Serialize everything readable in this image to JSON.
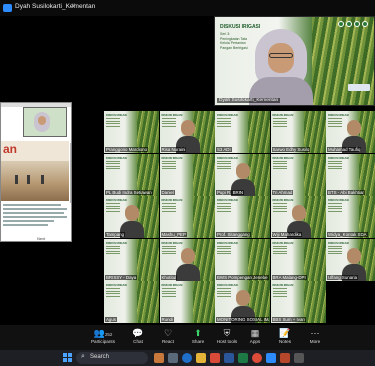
{
  "topbar": {
    "title": "Dyah Susilokarti_Kementan",
    "chevron": "∨"
  },
  "presenter": {
    "heading": "DISKUSI IRIGASI",
    "subtitle": "Seri 3: Peningkatan Tata Kelola Pertanian Pangan Beririgasi",
    "name": "Dyah Susilokarti_Kementan"
  },
  "shared_doc": {
    "heading": "an",
    "page": "Next"
  },
  "gallery": {
    "participants": [
      "Pranggono Mardiono",
      "Risa Nuraini",
      "S3 ADI",
      "Sarwo Edhy Susilo",
      "Muhamad Taufiq",
      "PL Budi Indra Setiawan",
      "Daniel",
      "Pupi R. BRIN",
      "Tri Ahmad",
      "BTS - Abi Bakhtiar",
      "Tampang",
      "Mashu_PEP",
      "Prof. Sitanggang",
      "Wiji Mahardika",
      "Widya_Kontak SDA",
      "BRISSY - Daya",
      "Khotitul",
      "BWS Pompengan Jenebe",
      "BRA Malang-DPI",
      "Ulfang Sunaria",
      "Agus",
      "Rundi",
      "MONITORING SOSIAL IMAMUDDIN",
      "BBS Sum + Ivan"
    ]
  },
  "toolbar": {
    "participants": {
      "label": "Participants",
      "count": "252",
      "icon": "people-icon"
    },
    "chat": {
      "label": "Chat",
      "icon": "chat-icon"
    },
    "react": {
      "label": "React",
      "icon": "heart-icon"
    },
    "share": {
      "label": "Share",
      "icon": "share-arrow-icon"
    },
    "host_tools": {
      "label": "Host tools",
      "icon": "shield-icon"
    },
    "apps": {
      "label": "Apps",
      "icon": "apps-icon"
    },
    "notes": {
      "label": "Notes",
      "icon": "notes-icon"
    },
    "more": {
      "label": "More",
      "icon": "more-dots-icon"
    }
  },
  "taskbar": {
    "search_label": "Search"
  },
  "colors": {
    "zoom_blue": "#2d8cff",
    "share_green": "#3ad16a",
    "leaf_green": "#3e6b24"
  }
}
